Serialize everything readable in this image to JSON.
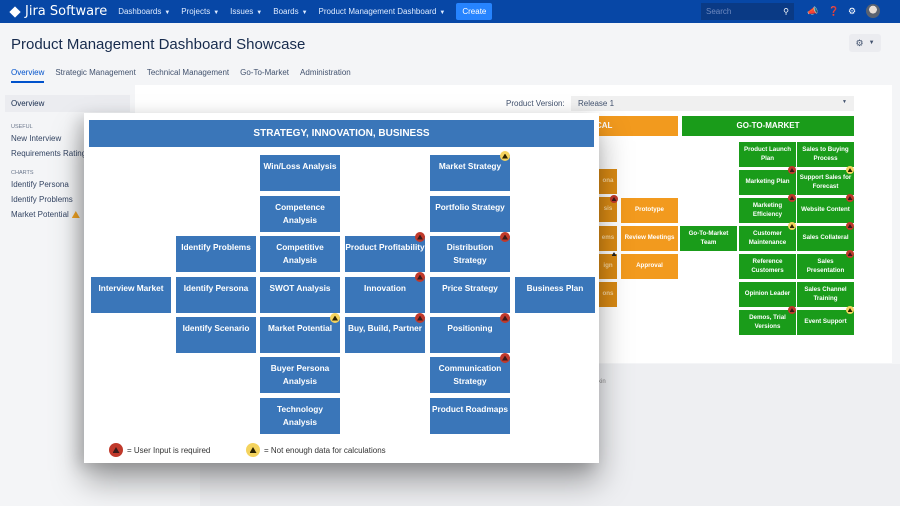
{
  "topbar": {
    "app_name": "Jira Software",
    "nav": [
      "Dashboards",
      "Projects",
      "Issues",
      "Boards",
      "Product Management Dashboard"
    ],
    "create_label": "Create",
    "search_placeholder": "Search"
  },
  "page": {
    "title": "Product Management Dashboard Showcase",
    "tabs": [
      "Overview",
      "Strategic Management",
      "Technical Management",
      "Go-To-Market",
      "Administration"
    ],
    "active_tab": "Overview"
  },
  "sidebar": {
    "overview": "Overview",
    "sections": [
      {
        "title": "USEFUL",
        "items": [
          "New Interview",
          "Requirements Rating"
        ]
      },
      {
        "title": "CHARTS",
        "items": [
          "Identify Persona",
          "Identify Problems",
          "Market Potential"
        ]
      }
    ]
  },
  "filter": {
    "label": "Product Version:",
    "value": "Release 1"
  },
  "background_board": {
    "technical_header": "CAL",
    "gtm_header": "GO-TO-MARKET",
    "orange_partial": [
      "ona",
      "sis",
      "ems",
      "ign",
      "ons"
    ],
    "orange_items": [
      "Prototype",
      "Review Meetings",
      "Approval"
    ],
    "gtm_team": "Go-To-Market Team",
    "gtm_left": [
      "Product Launch Plan",
      "Marketing Plan",
      "Marketing Efficiency",
      "Customer Maintenance",
      "Reference Customers",
      "Opinion Leader",
      "Demos, Trial Versions"
    ],
    "gtm_right": [
      "Sales to Buying Process",
      "Support Sales for Forecast",
      "Website Content",
      "Sales Collateral",
      "Sales Presentation",
      "Sales Channel Training",
      "Event Support"
    ],
    "partial_text": "kin"
  },
  "overlay": {
    "title": "STRATEGY, INNOVATION, BUSINESS",
    "boxes": {
      "win_loss": "Win/Loss Analysis",
      "competence": "Competence Analysis",
      "competitive": "Competitive Analysis",
      "swot": "SWOT Analysis",
      "market_potential": "Market Potential",
      "buyer_persona": "Buyer Persona Analysis",
      "technology": "Technology Analysis",
      "identify_problems": "Identify Problems",
      "identify_persona": "Identify Persona",
      "identify_scenario": "Identify Scenario",
      "interview_market": "Interview Market",
      "product_profitability": "Product Profitability",
      "innovation": "Innovation",
      "buy_build": "Buy, Build, Partner",
      "market_strategy": "Market Strategy",
      "portfolio_strategy": "Portfolio Strategy",
      "distribution_strategy": "Distribution Strategy",
      "price_strategy": "Price Strategy",
      "positioning": "Positioning",
      "communication_strategy": "Communication Strategy",
      "product_roadmaps": "Product Roadmaps",
      "business_plan": "Business Plan"
    },
    "legend": {
      "red": "= User Input is required",
      "yellow": "= Not enough data for calculations"
    }
  },
  "colors": {
    "topbar": "#0747a6",
    "strategy_blue": "#3a76b9",
    "gtm_green": "#1a9c1a",
    "technical_orange": "#f29a1e",
    "badge_red": "#c0392b",
    "badge_yellow": "#f4d35e"
  }
}
